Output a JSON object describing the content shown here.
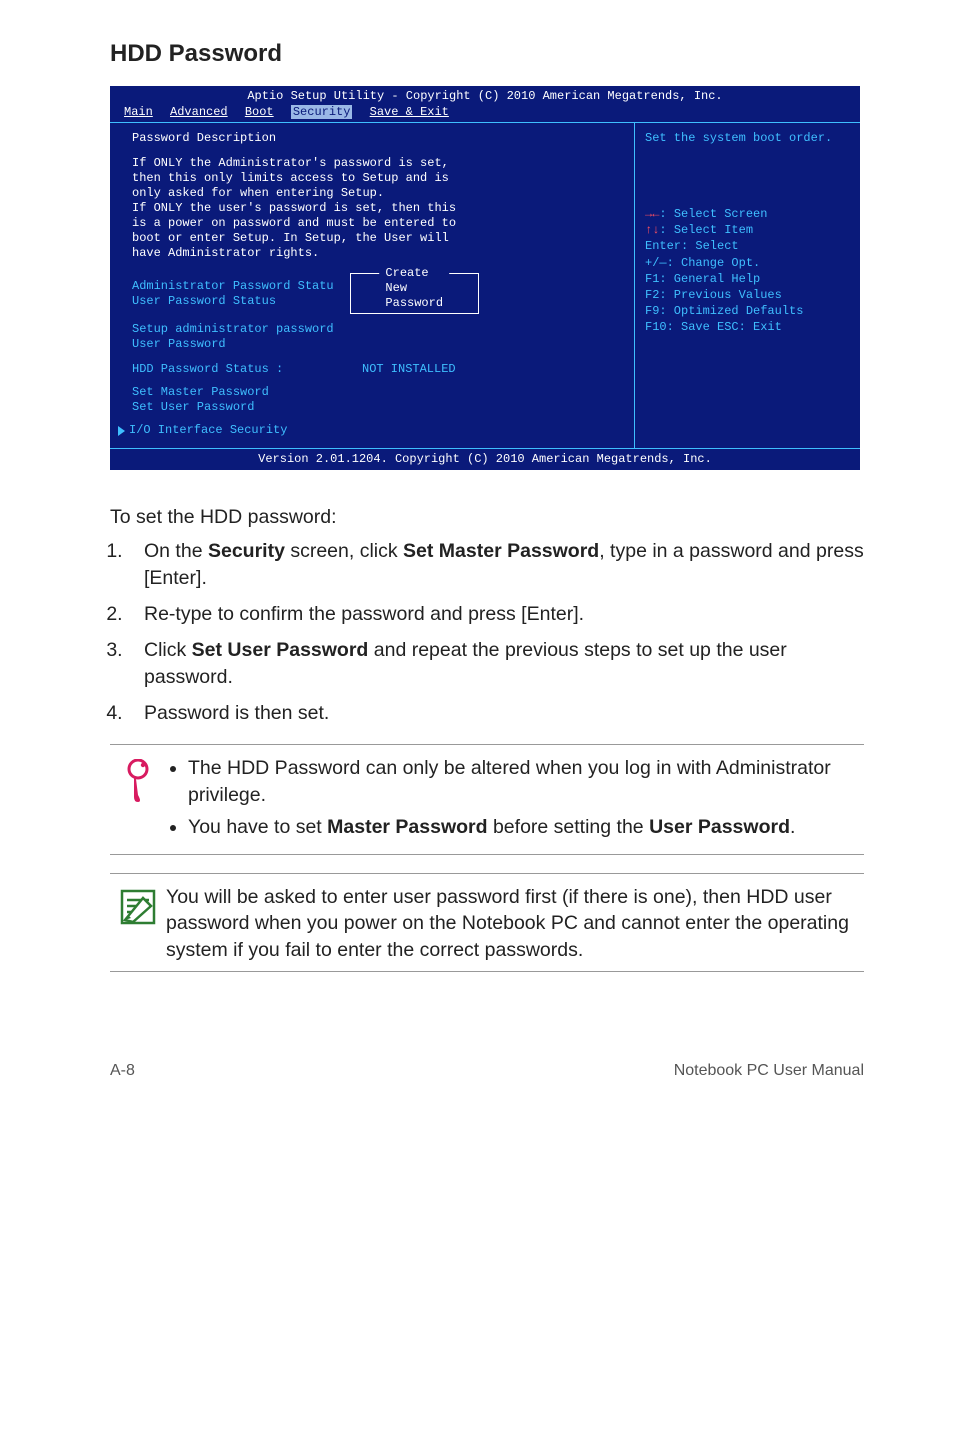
{
  "section_title": "HDD Password",
  "bios": {
    "title": "Aptio Setup Utility - Copyright (C) 2010 American Megatrends, Inc.",
    "tabs": [
      "Main",
      "Advanced",
      "Boot",
      "Security",
      "Save & Exit"
    ],
    "active_tab": "Security",
    "right_hint": "Set the system boot order.",
    "desc_heading": "Password Description",
    "desc_lines": [
      "If ONLY the Administrator's password is set,",
      "then this only limits access to Setup and is",
      "only asked for when entering Setup.",
      "If ONLY the user's password is set, then this",
      "is a power on password and must be entered to",
      "boot or enter Setup. In Setup, the User will",
      "have Administrator rights."
    ],
    "admin_status": "Administrator Password Statu",
    "user_status": "User Password Status",
    "dialog_title": "Create New Password",
    "setup_admin": "Setup administrator password",
    "user_pw": "User Password",
    "hdd_status_label": "HDD Password Status :",
    "hdd_status_value": "NOT INSTALLED",
    "set_master": "Set Master Password",
    "set_user": "Set User Password",
    "io_security": "I/O Interface Security",
    "nav": {
      "select_screen": "Select Screen",
      "select_item": "Select Item",
      "enter": "Enter: Select",
      "change": "+/—:  Change Opt.",
      "f1": "F1:   General Help",
      "f2": "F2:   Previous Values",
      "f9": "F9:   Optimized Defaults",
      "f10": "F10:  Save   ESC: Exit"
    },
    "footer": "Version 2.01.1204. Copyright (C) 2010 American Megatrends, Inc."
  },
  "intro": "To set the HDD password:",
  "steps": {
    "s1a": "On the ",
    "s1b": "Security",
    "s1c": " screen, click ",
    "s1d": "Set Master Password",
    "s1e": ", type in a password and press [Enter].",
    "s2": "Re-type to confirm the password and press [Enter].",
    "s3a": "Click ",
    "s3b": "Set User Password",
    "s3c": " and repeat the previous steps to set up the user password.",
    "s4": "Password is then set."
  },
  "note1": {
    "b1": "The HDD Password can only be altered when you log in with Administrator privilege.",
    "b2a": "You have to set ",
    "b2b": "Master Password",
    "b2c": " before setting the ",
    "b2d": "User Password",
    "b2e": "."
  },
  "note2": "You will be asked to enter user password first (if there is one), then HDD user password when you power on the Notebook PC and cannot enter the operating system if you fail to enter the correct passwords.",
  "footer_left": "A-8",
  "footer_right": "Notebook PC User Manual"
}
